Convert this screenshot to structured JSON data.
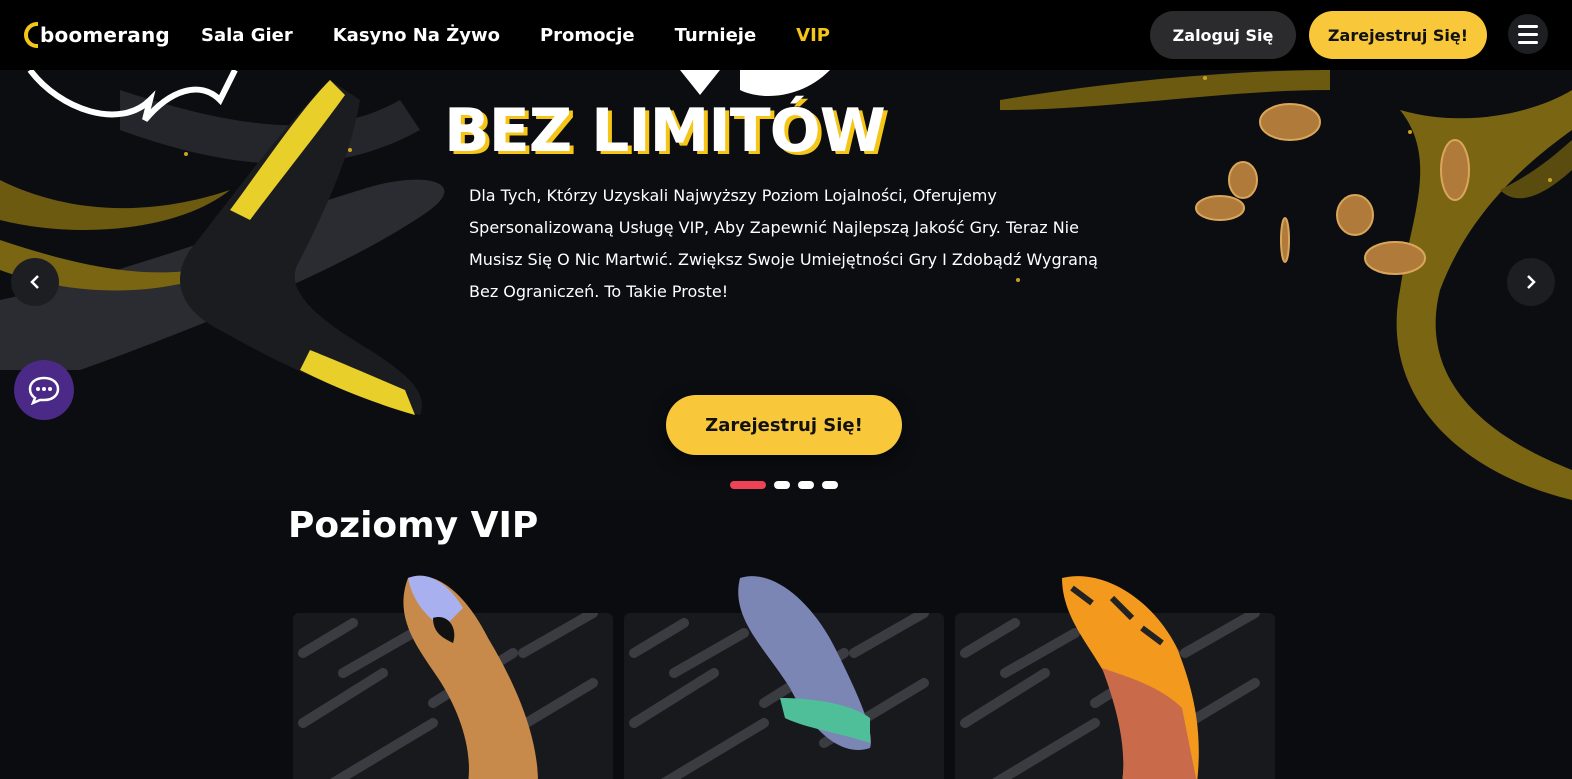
{
  "header": {
    "logo_text": "boomerang",
    "nav": [
      "Sala Gier",
      "Kasyno Na Żywo",
      "Promocje",
      "Turnieje",
      "VIP"
    ],
    "login_label": "Zaloguj Się",
    "register_label": "Zarejestruj Się!"
  },
  "hero": {
    "title": "BEZ LIMITÓW",
    "description": "Dla Tych, Którzy Uzyskali Najwyższy Poziom Lojalności, Oferujemy Spersonalizowaną Usługę VIP, Aby Zapewnić Najlepszą Jakość Gry. Teraz Nie Musisz Się O Nic Martwić. Zwiększ Swoje Umiejętności Gry I Zdobądź Wygraną Bez Ograniczeń. To Takie Proste!",
    "cta_label": "Zarejestruj Się!",
    "slides_total": 4,
    "active_slide": 1
  },
  "vip": {
    "title": "Poziomy VIP"
  },
  "colors": {
    "accent": "#f9c83a",
    "active_dot": "#ee4356",
    "chat_bg": "#4a2a86",
    "bg": "#0a0c10"
  },
  "icons": [
    "chevron-left-icon",
    "chevron-right-icon",
    "chat-bubble-icon",
    "hamburger-menu-icon"
  ]
}
